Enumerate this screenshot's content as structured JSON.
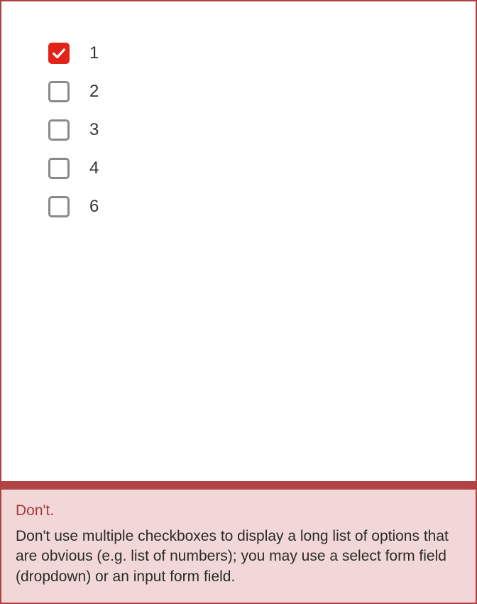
{
  "example": {
    "options": [
      {
        "label": "1",
        "checked": true
      },
      {
        "label": "2",
        "checked": false
      },
      {
        "label": "3",
        "checked": false
      },
      {
        "label": "4",
        "checked": false
      },
      {
        "label": "6",
        "checked": false
      }
    ]
  },
  "caution": {
    "title": "Don't.",
    "text": "Don't use multiple checkboxes to display a long list of options that are obvious (e.g. list of numbers); you may use a select form field (dropdown) or an input form field."
  },
  "colors": {
    "border": "#b04040",
    "caution_bar": "#b04343",
    "caution_bg": "#f1d7d7",
    "caution_title": "#a63a3a",
    "checkbox_checked": "#e2231a",
    "checkbox_border": "#8a8a8a"
  }
}
